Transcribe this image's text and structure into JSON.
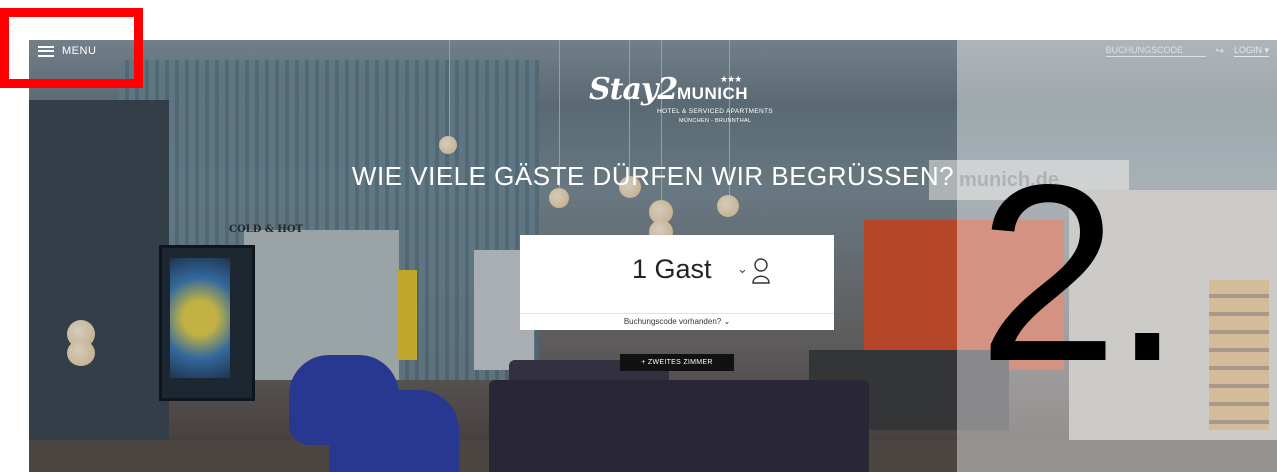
{
  "header": {
    "menu_label": "MENU",
    "booking_code_link": "BUCHUNGSCODE",
    "login_label": "LOGIN"
  },
  "logo": {
    "script": "Stay2",
    "city": "MUNICH",
    "stars": "★★★",
    "subtitle": "HOTEL & SERVICED APARTMENTS",
    "location": "MÜNCHEN - BRUNNTHAL"
  },
  "scene": {
    "coffee_sign": "COLD & HOT",
    "wall_sign": "munich.de"
  },
  "hero": {
    "headline": "WIE VIELE GÄSTE DÜRFEN WIR BEGRÜSSEN?"
  },
  "booking": {
    "guest_count": "1 Gast",
    "booking_code_prompt": "Buchungscode vorhanden?",
    "second_room_button": "+ ZWEITES ZIMMER"
  },
  "annotation": {
    "step_number": "2.",
    "highlight_color": "#ff0000"
  }
}
